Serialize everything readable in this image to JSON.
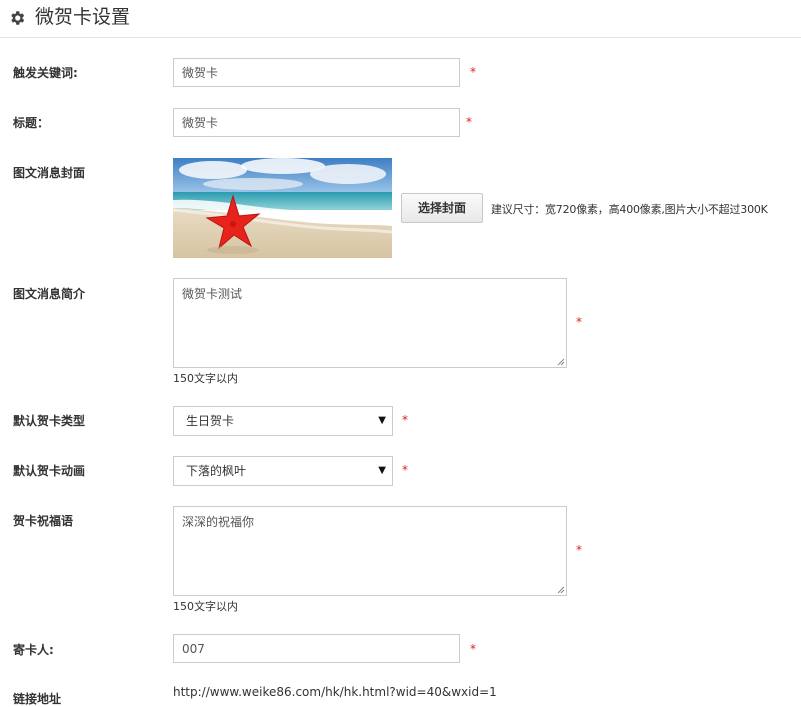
{
  "header": {
    "title": "微贺卡设置",
    "icon": "gear-icon"
  },
  "form": {
    "keyword": {
      "label": "触发关键词:",
      "value": "微贺卡",
      "required_mark": "*"
    },
    "title": {
      "label": "标题：",
      "value": "微贺卡",
      "required_mark": "*"
    },
    "cover": {
      "label": "图文消息封面",
      "button_label": "选择封面",
      "hint": "建议尺寸：宽720像素，高400像素,图片大小不超过300K"
    },
    "summary": {
      "label": "图文消息简介",
      "value": "微贺卡测试",
      "required_mark": "*",
      "limit_note": "150文字以内"
    },
    "card_type": {
      "label": "默认贺卡类型",
      "selected": "生日贺卡",
      "required_mark": "*"
    },
    "card_animation": {
      "label": "默认贺卡动画",
      "selected": "下落的枫叶",
      "required_mark": "*"
    },
    "greeting": {
      "label": "贺卡祝福语",
      "value": "深深的祝福你",
      "required_mark": "*",
      "limit_note": "150文字以内"
    },
    "sender": {
      "label": "寄卡人:",
      "value": "007",
      "required_mark": "*"
    },
    "link": {
      "label": "链接地址",
      "value": "http://www.weike86.com/hk/hk.html?wid=40&wxid=1"
    }
  },
  "colors": {
    "required": "#d9231d",
    "border": "#cccccc",
    "text": "#333333"
  }
}
